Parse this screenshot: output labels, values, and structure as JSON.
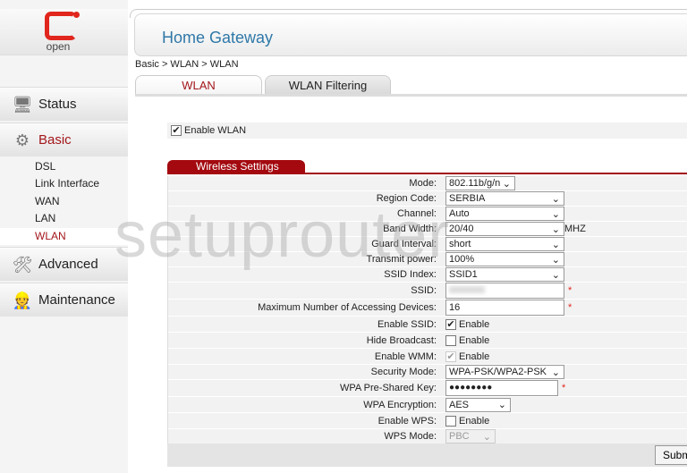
{
  "logo": {
    "text": "open"
  },
  "sidebar": {
    "items": [
      {
        "label": "Status",
        "icon": "monitor-info-icon"
      },
      {
        "label": "Basic",
        "icon": "gear-icon"
      },
      {
        "label": "Advanced",
        "icon": "tools-icon"
      },
      {
        "label": "Maintenance",
        "icon": "person-icon"
      }
    ],
    "sub": [
      "DSL",
      "Link Interface",
      "WAN",
      "LAN",
      "WLAN"
    ]
  },
  "header": {
    "title": "Home Gateway"
  },
  "breadcrumb": "Basic > WLAN > WLAN",
  "tabs": [
    "WLAN",
    "WLAN Filtering"
  ],
  "enable_wlan": {
    "label": "Enable WLAN",
    "checked": true
  },
  "section": "Wireless Settings",
  "fields": {
    "mode": {
      "label": "Mode:",
      "value": "802.11b/g/n"
    },
    "region": {
      "label": "Region Code:",
      "value": "SERBIA"
    },
    "channel": {
      "label": "Channel:",
      "value": "Auto"
    },
    "bandwidth": {
      "label": "Band Width:",
      "value": "20/40",
      "unit": "MHZ"
    },
    "guard": {
      "label": "Guard Interval:",
      "value": "short"
    },
    "power": {
      "label": "Transmit power:",
      "value": "100%"
    },
    "ssid_index": {
      "label": "SSID Index:",
      "value": "SSID1"
    },
    "ssid": {
      "label": "SSID:",
      "value": ""
    },
    "max_dev": {
      "label": "Maximum Number of Accessing Devices:",
      "value": "16"
    },
    "enable_ssid": {
      "label": "Enable SSID:",
      "text": "Enable",
      "checked": true
    },
    "hide": {
      "label": "Hide Broadcast:",
      "text": "Enable",
      "checked": false
    },
    "wmm": {
      "label": "Enable WMM:",
      "text": "Enable",
      "checked": true,
      "disabled": true
    },
    "security": {
      "label": "Security Mode:",
      "value": "WPA-PSK/WPA2-PSK"
    },
    "psk": {
      "label": "WPA Pre-Shared Key:",
      "value": "●●●●●●●●"
    },
    "encryption": {
      "label": "WPA Encryption:",
      "value": "AES"
    },
    "wps": {
      "label": "Enable WPS:",
      "text": "Enable",
      "checked": false
    },
    "wps_mode": {
      "label": "WPS Mode:",
      "value": "PBC"
    }
  },
  "required_mark": "*",
  "submit": "Submit",
  "watermark": "setuprouter",
  "colors": {
    "accent": "#a3090f",
    "title": "#2f78a8",
    "logo": "#e0261d"
  }
}
